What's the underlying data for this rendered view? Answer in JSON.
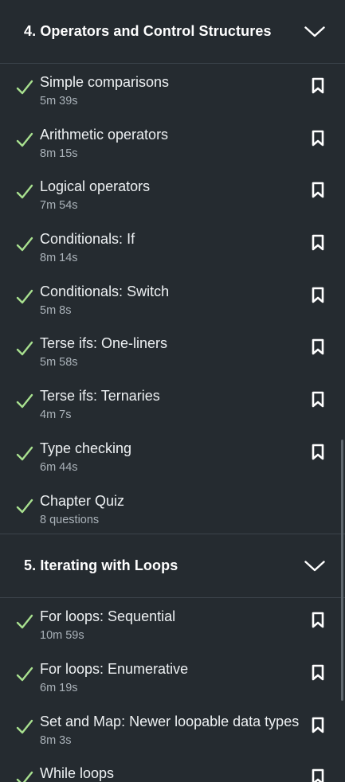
{
  "chapters": [
    {
      "title": "4. Operators and Control Structures",
      "expanded": true,
      "items": [
        {
          "title": "Simple comparisons",
          "meta": "5m 39s",
          "bookmark": true
        },
        {
          "title": "Arithmetic operators",
          "meta": "8m 15s",
          "bookmark": true
        },
        {
          "title": "Logical operators",
          "meta": "7m 54s",
          "bookmark": true
        },
        {
          "title": "Conditionals: If",
          "meta": "8m 14s",
          "bookmark": true
        },
        {
          "title": "Conditionals: Switch",
          "meta": "5m 8s",
          "bookmark": true
        },
        {
          "title": "Terse ifs: One-liners",
          "meta": "5m 58s",
          "bookmark": true
        },
        {
          "title": "Terse ifs: Ternaries",
          "meta": "4m 7s",
          "bookmark": true
        },
        {
          "title": "Type checking",
          "meta": "6m 44s",
          "bookmark": true
        },
        {
          "title": "Chapter Quiz",
          "meta": "8 questions",
          "bookmark": false
        }
      ]
    },
    {
      "title": "5. Iterating with Loops",
      "expanded": true,
      "items": [
        {
          "title": "For loops: Sequential",
          "meta": "10m 59s",
          "bookmark": true
        },
        {
          "title": "For loops: Enumerative",
          "meta": "6m 19s",
          "bookmark": true
        },
        {
          "title": "Set and Map: Newer loopable data types",
          "meta": "8m 3s",
          "bookmark": true
        },
        {
          "title": "While loops",
          "meta": "",
          "bookmark": true
        }
      ]
    }
  ],
  "colors": {
    "background": "#252b30",
    "check": "#a8e08f",
    "divider": "#3c444b"
  },
  "icons": {
    "completed": "checkmark-icon",
    "bookmark": "bookmark-icon",
    "collapse": "chevron-down-icon"
  }
}
